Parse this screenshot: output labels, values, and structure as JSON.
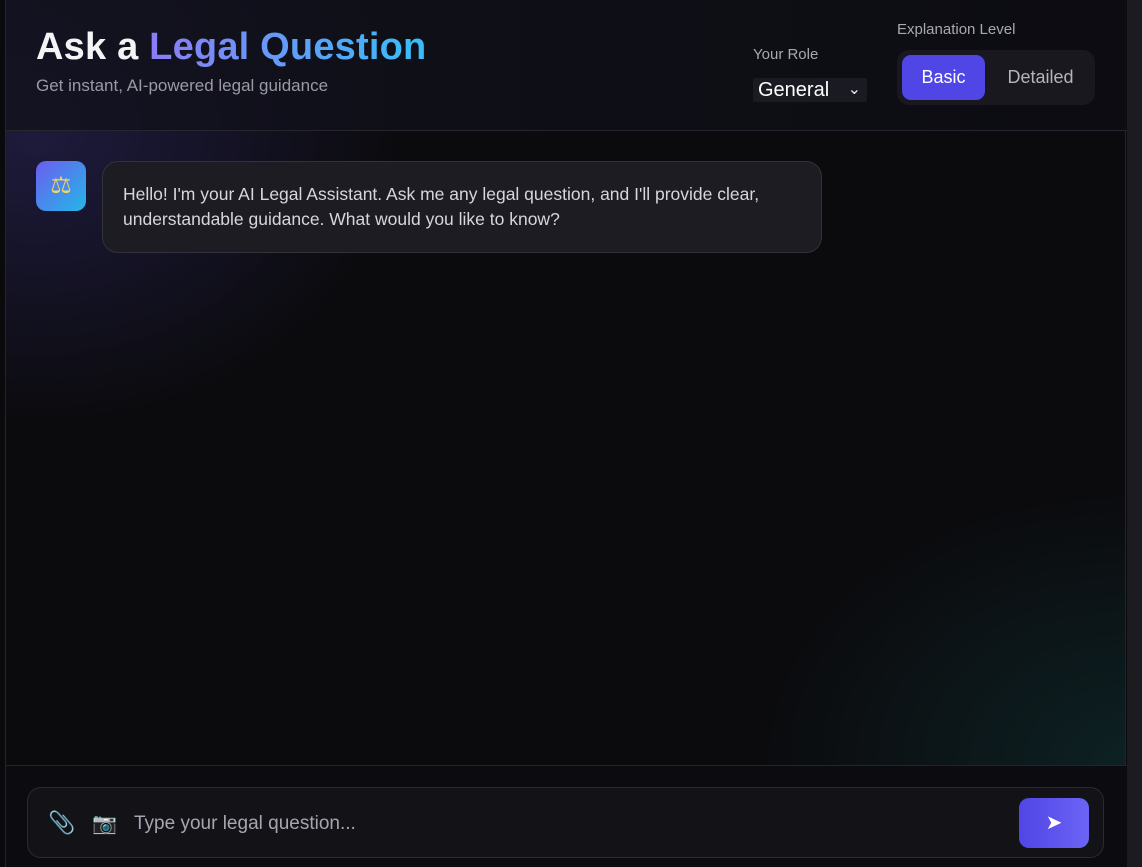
{
  "header": {
    "title_prefix": "Ask a",
    "title_highlight": "Legal Question",
    "subtitle": "Get instant, AI-powered legal guidance",
    "role": {
      "label": "Your Role",
      "selected": "General"
    },
    "level": {
      "label": "Explanation Level",
      "options": [
        "Basic",
        "Detailed"
      ],
      "active": "Basic"
    }
  },
  "messages": [
    {
      "sender": "assistant",
      "avatar_icon": "scales-icon",
      "text": "Hello! I'm your AI Legal Assistant. Ask me any legal question, and I'll provide clear, understandable guidance. What would you like to know?"
    }
  ],
  "composer": {
    "attach_icon": "paperclip-icon",
    "camera_icon": "camera-icon",
    "placeholder": "Type your legal question...",
    "send_icon": "send-arrow-icon"
  },
  "colors": {
    "accent": "#4f46e5",
    "gradient_start": "#8b7cf6",
    "gradient_end": "#38bdf8"
  }
}
